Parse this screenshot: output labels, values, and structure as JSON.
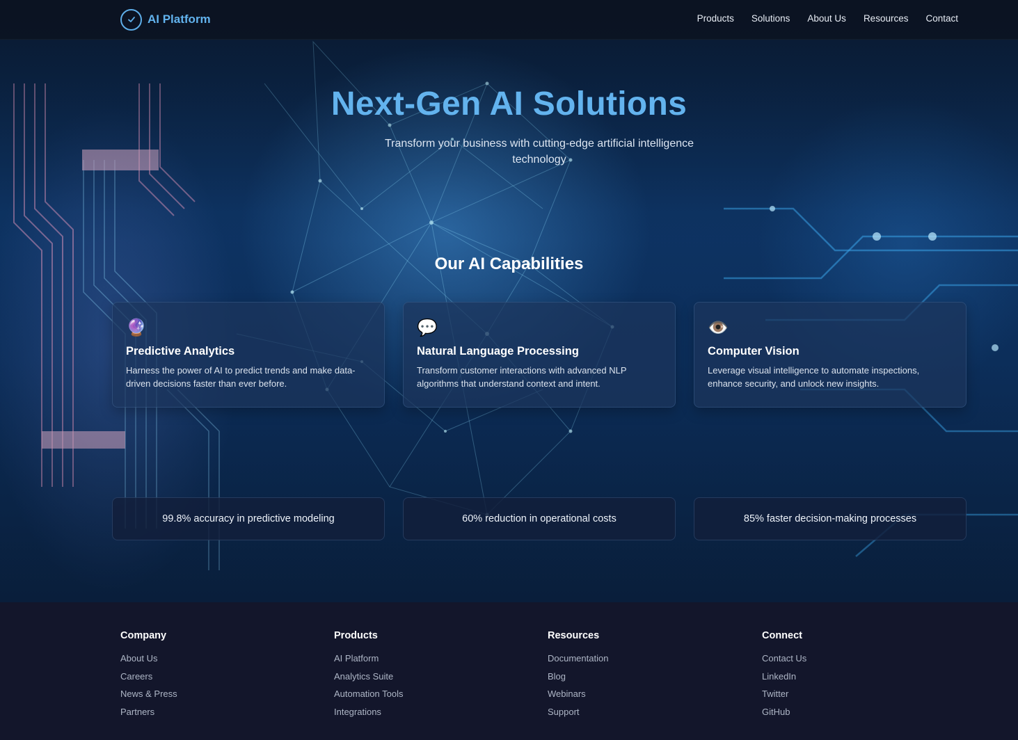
{
  "nav": {
    "logo_text": "AI Platform",
    "links": [
      "Products",
      "Solutions",
      "About Us",
      "Resources",
      "Contact"
    ]
  },
  "hero": {
    "title": "Next-Gen AI Solutions",
    "subtitle": "Transform your business with cutting-edge artificial intelligence technology"
  },
  "capabilities": {
    "title": "Our AI Capabilities",
    "cards": [
      {
        "icon": "crystal-ball-icon",
        "emoji": "🔮",
        "title": "Predictive Analytics",
        "desc": "Harness the power of AI to predict trends and make data-driven decisions faster than ever before."
      },
      {
        "icon": "speech-bubble-icon",
        "emoji": "💬",
        "title": "Natural Language Processing",
        "desc": "Transform customer interactions with advanced NLP algorithms that understand context and intent."
      },
      {
        "icon": "eye-icon",
        "emoji": "👁️",
        "title": "Computer Vision",
        "desc": "Leverage visual intelligence to automate inspections, enhance security, and unlock new insights."
      }
    ]
  },
  "stats": [
    "99.8% accuracy in predictive modeling",
    "60% reduction in operational costs",
    "85% faster decision-making processes"
  ],
  "footer": {
    "columns": [
      {
        "heading": "Company",
        "links": [
          "About Us",
          "Careers",
          "News & Press",
          "Partners"
        ]
      },
      {
        "heading": "Products",
        "links": [
          "AI Platform",
          "Analytics Suite",
          "Automation Tools",
          "Integrations"
        ]
      },
      {
        "heading": "Resources",
        "links": [
          "Documentation",
          "Blog",
          "Webinars",
          "Support"
        ]
      },
      {
        "heading": "Connect",
        "links": [
          "Contact Us",
          "LinkedIn",
          "Twitter",
          "GitHub"
        ]
      }
    ]
  },
  "colors": {
    "accent": "#63b3ee",
    "footer_bg": "#13162b"
  }
}
